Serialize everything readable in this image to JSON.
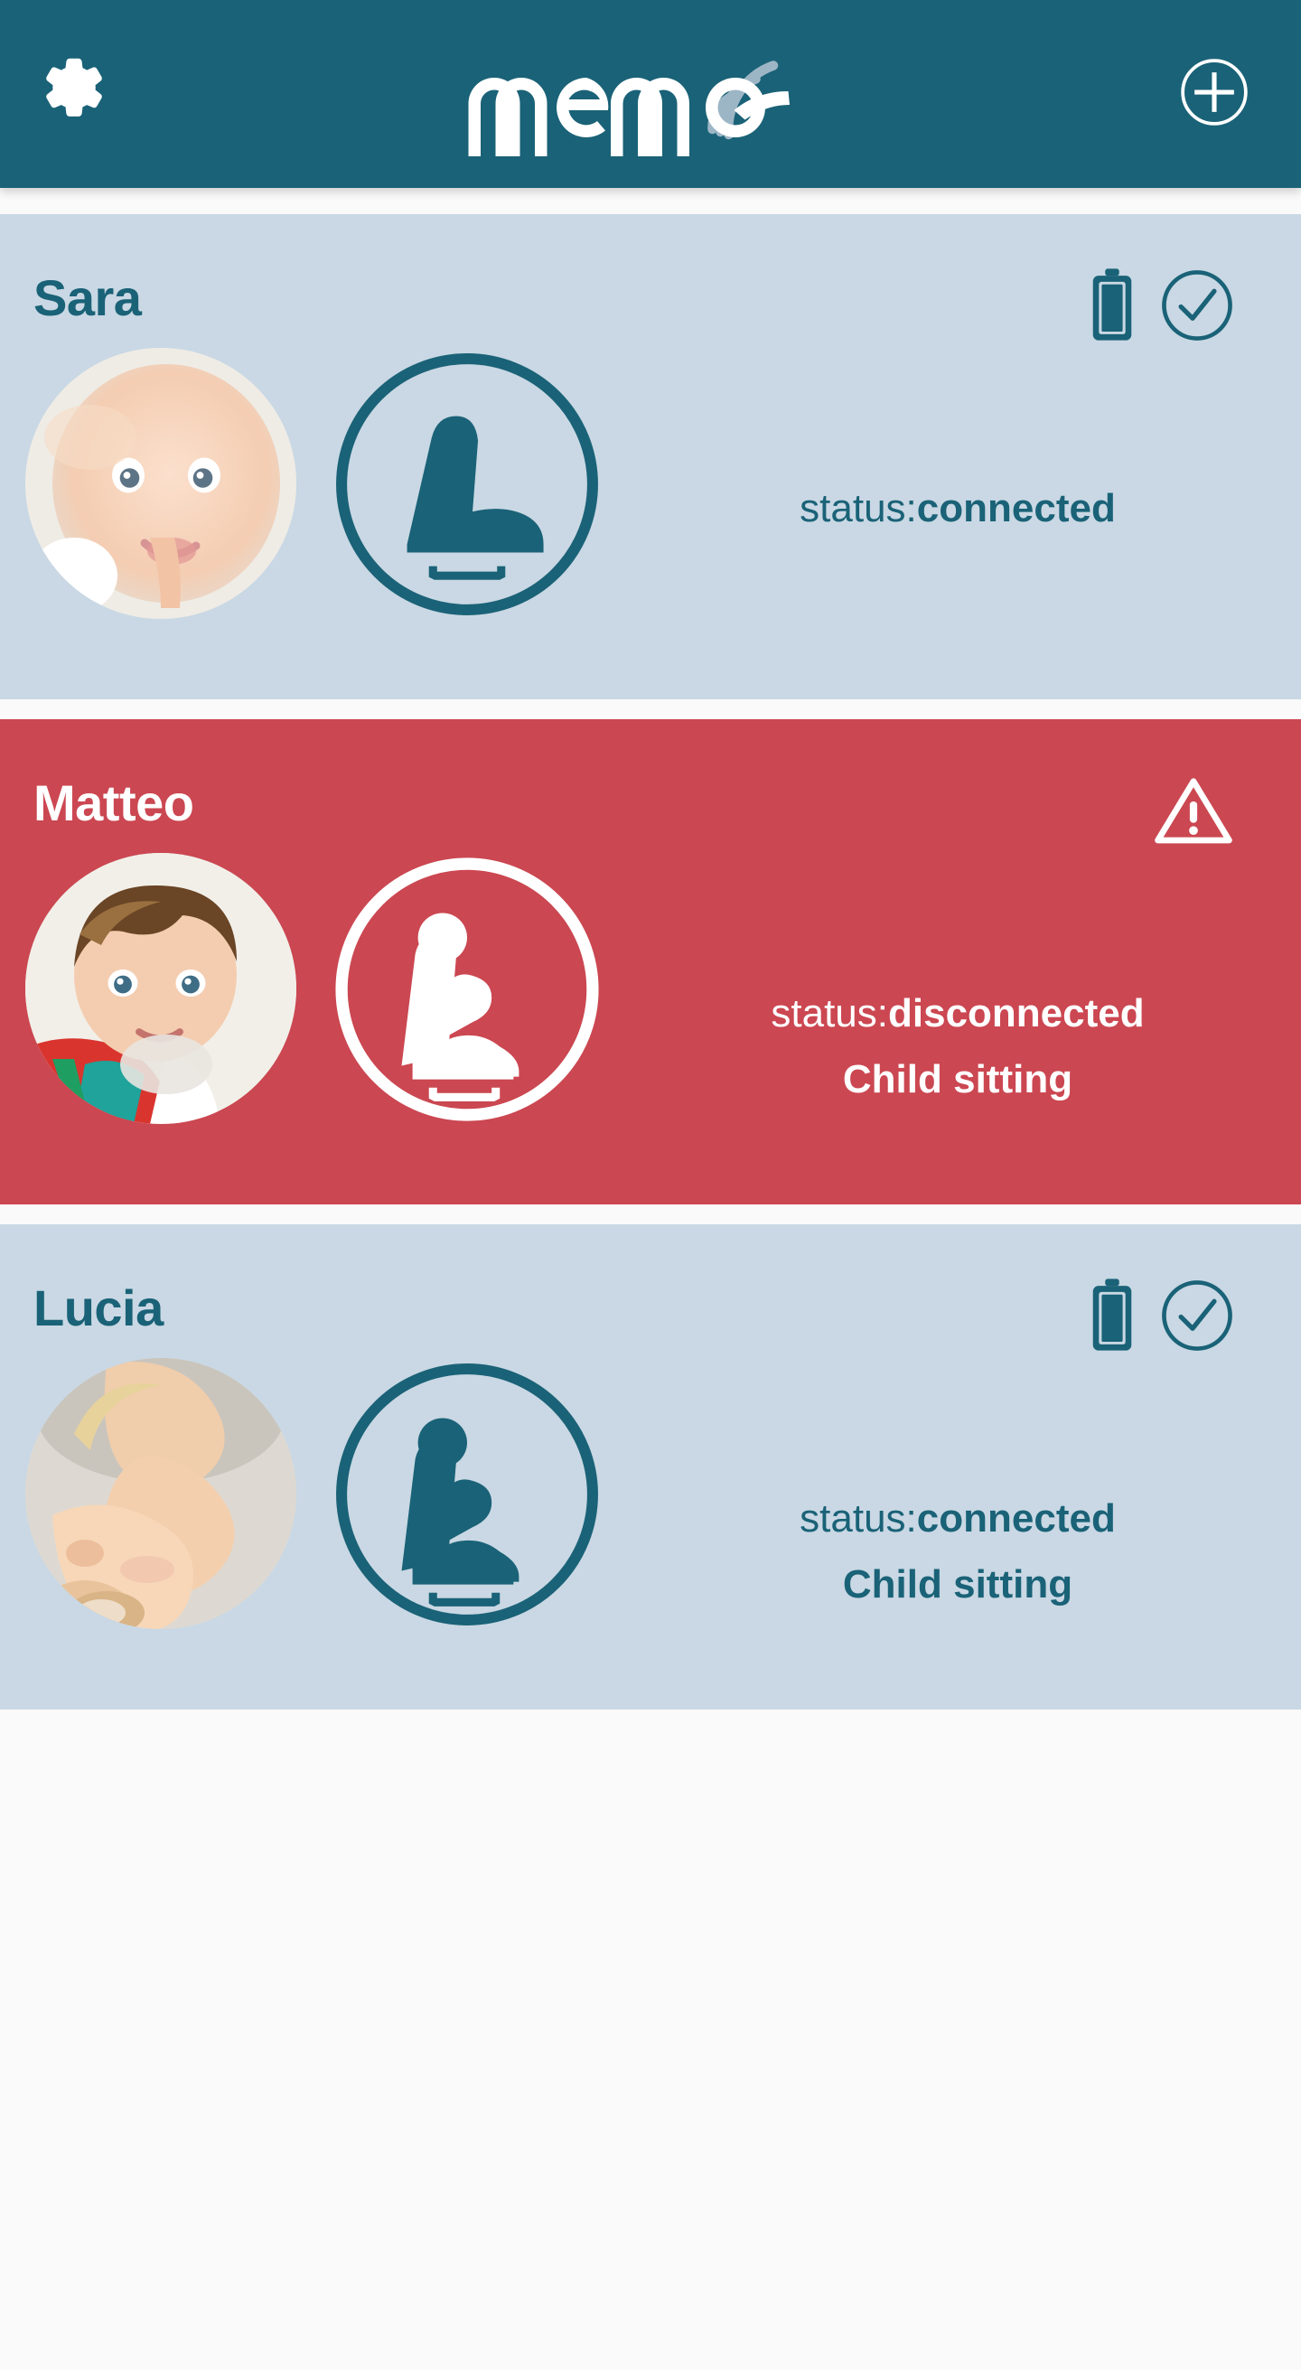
{
  "app": {
    "title": "memo",
    "header": {
      "settings_icon": "gear-icon",
      "logo_text": "memo",
      "logo_signal_icon": "wifi-signal-icon",
      "add_icon": "plus-circle-icon"
    },
    "colors": {
      "header_bg": "#1a6277",
      "teal": "#1a6277",
      "card_ok_bg": "#c9d8e4",
      "card_alert_bg": "#cb4751",
      "white": "#ffffff",
      "signal_arc": "#9db6c6",
      "page_bg": "#fafafa"
    }
  },
  "cards": [
    {
      "name": "Sara",
      "state": "ok",
      "avatar_icon": "baby-photo-avatar",
      "seat_icon": "car-seat-empty-icon",
      "status_label": "status:",
      "status_value": "connected",
      "occupancy_text": "",
      "occupancy_visible": false,
      "battery_icon": "battery-full-icon",
      "battery_visible": true,
      "check_icon": "check-circle-icon",
      "check_visible": true,
      "warning_icon": "warning-triangle-icon",
      "warning_visible": false
    },
    {
      "name": "Matteo",
      "state": "alert",
      "avatar_icon": "child-photo-avatar",
      "seat_icon": "car-seat-occupied-icon",
      "status_label": "status:",
      "status_value": "disconnected",
      "occupancy_text": "Child sitting",
      "occupancy_visible": true,
      "battery_icon": "battery-full-icon",
      "battery_visible": false,
      "check_icon": "check-circle-icon",
      "check_visible": false,
      "warning_icon": "warning-triangle-icon",
      "warning_visible": true
    },
    {
      "name": "Lucia",
      "state": "ok",
      "avatar_icon": "toddler-photo-avatar",
      "seat_icon": "car-seat-occupied-icon",
      "status_label": "status:",
      "status_value": "connected",
      "occupancy_text": "Child sitting",
      "occupancy_visible": true,
      "battery_icon": "battery-full-icon",
      "battery_visible": true,
      "check_icon": "check-circle-icon",
      "check_visible": true,
      "warning_icon": "warning-triangle-icon",
      "warning_visible": false
    }
  ]
}
